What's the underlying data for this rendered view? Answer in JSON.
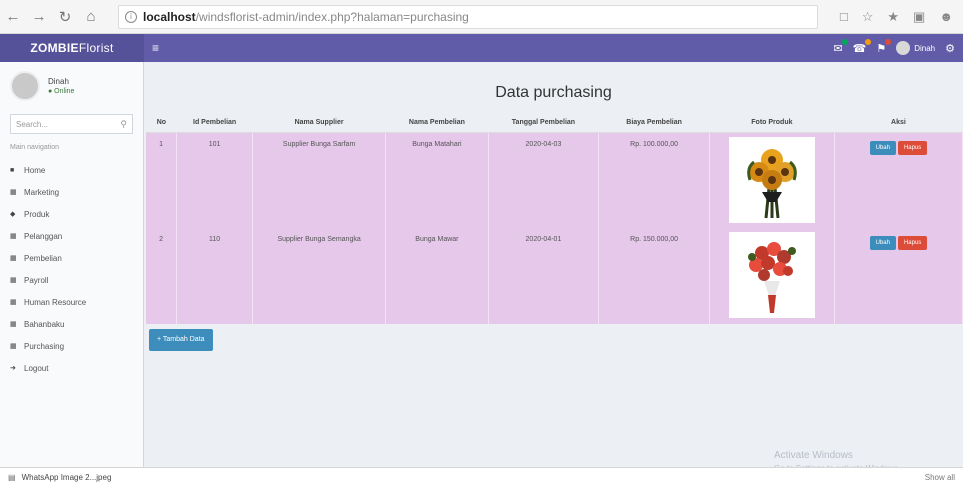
{
  "browser": {
    "url_host": "localhost",
    "url_path": "/windsflorist-admin/index.php?halaman=purchasing"
  },
  "app": {
    "logo_bold": "ZOMBIE",
    "logo_light": " Florist",
    "user_name": "Dinah",
    "user_status": "● Online",
    "user_name_small": "Dinah"
  },
  "sidebar": {
    "search_placeholder": "Search...",
    "menu_header": "Main navigation",
    "items": [
      {
        "label": "Home"
      },
      {
        "label": "Marketing"
      },
      {
        "label": "Produk"
      },
      {
        "label": "Pelanggan"
      },
      {
        "label": "Pembelian"
      },
      {
        "label": "Payroll"
      },
      {
        "label": "Human Resource"
      },
      {
        "label": "Bahanbaku"
      },
      {
        "label": "Purchasing"
      },
      {
        "label": "Logout"
      }
    ]
  },
  "main": {
    "title": "Data purchasing",
    "columns": [
      "No",
      "Id Pembelian",
      "Nama Supplier",
      "Nama Pembelian",
      "Tanggal Pembelian",
      "Biaya Pembelian",
      "Foto Produk",
      "Aksi"
    ],
    "rows": [
      {
        "no": "1",
        "id": "101",
        "supplier": "Supplier Bunga Sarfam",
        "nama": "Bunga Matahari",
        "tanggal": "2020-04-03",
        "biaya": "Rp. 100.000,00",
        "foto": "sunflower-bouquet"
      },
      {
        "no": "2",
        "id": "110",
        "supplier": "Supplier Bunga Semangka",
        "nama": "Bunga Mawar",
        "tanggal": "2020-04-01",
        "biaya": "Rp. 150.000,00",
        "foto": "rose-bouquet"
      }
    ],
    "edit_label": "Ubah",
    "delete_label": "Hapus",
    "add_label": "+ Tambah Data"
  },
  "watermark": {
    "line1": "Activate Windows",
    "line2": "Go to Settings to activate Windows."
  },
  "download_bar": {
    "file": "WhatsApp Image 2...jpeg",
    "show_all": "Show all"
  }
}
